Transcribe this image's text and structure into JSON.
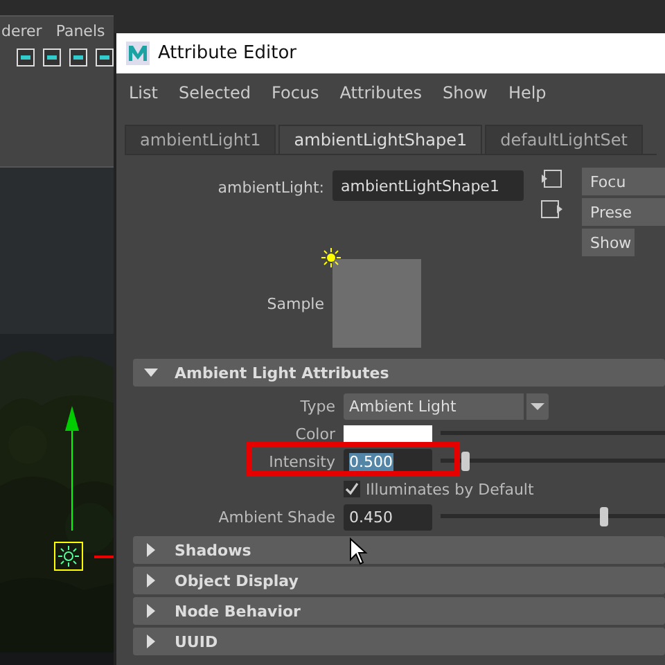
{
  "host_menu": [
    "derer",
    "Panels"
  ],
  "window": {
    "title": "Attribute Editor"
  },
  "menu": [
    "List",
    "Selected",
    "Focus",
    "Attributes",
    "Show",
    "Help"
  ],
  "tabs": [
    {
      "label": "ambientLight1",
      "selected": false
    },
    {
      "label": "ambientLightShape1",
      "selected": true
    },
    {
      "label": "defaultLightSet",
      "selected": false
    }
  ],
  "node": {
    "label": "ambientLight:",
    "value": "ambientLightShape1"
  },
  "side_buttons": [
    "Focu",
    "Prese",
    "Show"
  ],
  "sample": {
    "label": "Sample"
  },
  "sections": [
    {
      "title": "Ambient Light Attributes",
      "expanded": true,
      "attributes": [
        {
          "kind": "dropdown",
          "label": "Type",
          "value": "Ambient Light"
        },
        {
          "kind": "color",
          "label": "Color"
        },
        {
          "kind": "slider",
          "label": "Intensity",
          "value": "0.500",
          "level": 0.11,
          "highlighted": true,
          "selected": true
        },
        {
          "kind": "checkbox",
          "label": "Illuminates by Default",
          "checked": true
        },
        {
          "kind": "slider",
          "label": "Ambient Shade",
          "value": "0.450",
          "level": 0.73,
          "highlighted": false,
          "selected": false
        }
      ]
    },
    {
      "title": "Shadows",
      "expanded": false
    },
    {
      "title": "Object Display",
      "expanded": false
    },
    {
      "title": "Node Behavior",
      "expanded": false
    },
    {
      "title": "UUID",
      "expanded": false
    }
  ]
}
